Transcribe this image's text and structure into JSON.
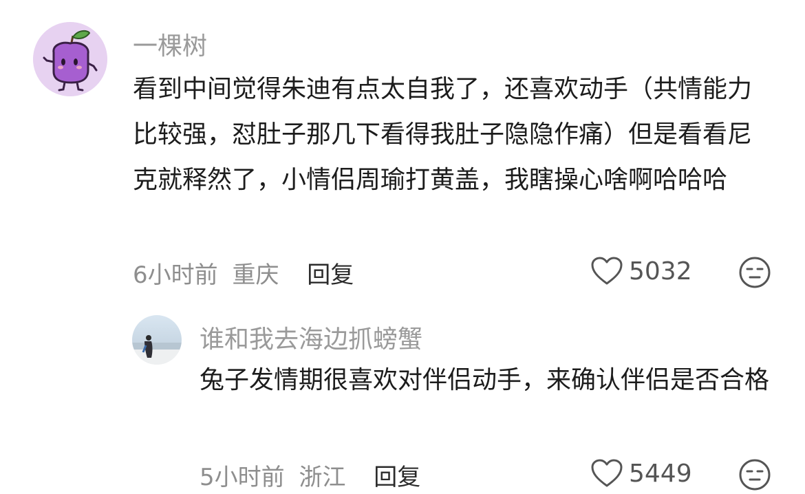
{
  "comments": [
    {
      "username": "一棵树",
      "avatar_icon": "purple-fruit-avatar",
      "text": "看到中间觉得朱迪有点太自我了，还喜欢动手（共情能力比较强，怼肚子那几下看得我肚子隐隐作痛）但是看看尼克就释然了，小情侣周瑜打黄盖，我瞎操心啥啊哈哈哈",
      "time": "6小时前",
      "location": "重庆",
      "reply_label": "回复",
      "likes": "5032"
    },
    {
      "username": "谁和我去海边抓螃蟹",
      "avatar_icon": "beach-photo-avatar",
      "text": "兔子发情期很喜欢对伴侣动手，来确认伴侣是否合格",
      "time": "5小时前",
      "location": "浙江",
      "reply_label": "回复",
      "likes": "5449"
    }
  ],
  "icons": {
    "like": "heart-outline-icon",
    "emoji": "neutral-face-icon"
  },
  "colors": {
    "username": "#9a9a9a",
    "body_text": "#1c1c1c",
    "meta": "#8e8e8e",
    "reply": "#2b2b2b",
    "icon_stroke": "#555555"
  }
}
